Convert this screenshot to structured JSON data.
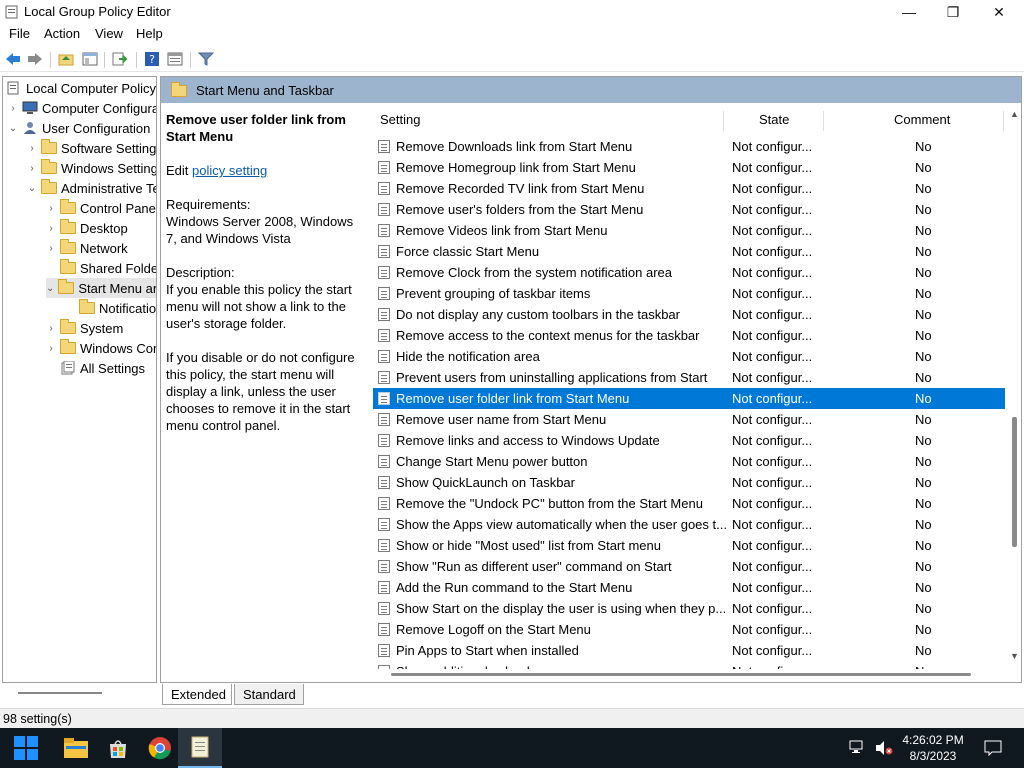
{
  "window": {
    "title": "Local Group Policy Editor",
    "controls": {
      "minimize": "—",
      "maximize": "❐",
      "close": "✕"
    }
  },
  "menu": [
    "File",
    "Action",
    "View",
    "Help"
  ],
  "toolbar_icons": [
    "back-icon",
    "forward-icon",
    "up-folder-icon",
    "show-hide-tree-icon",
    "export-list-icon",
    "help-icon",
    "properties-icon",
    "filter-icon"
  ],
  "tree": [
    {
      "label": "Local Computer Policy",
      "expander": "",
      "icon": "policy-icon"
    },
    {
      "label": "Computer Configuration",
      "expander": "›",
      "icon": "computer-icon"
    },
    {
      "label": "User Configuration",
      "expander": "⌄",
      "icon": "user-icon"
    },
    {
      "label": "Software Settings",
      "expander": "›",
      "icon": "folder-icon"
    },
    {
      "label": "Windows Settings",
      "expander": "›",
      "icon": "folder-icon"
    },
    {
      "label": "Administrative Templates",
      "expander": "⌄",
      "icon": "folder-icon"
    },
    {
      "label": "Control Panel",
      "expander": "›",
      "icon": "folder-icon"
    },
    {
      "label": "Desktop",
      "expander": "›",
      "icon": "folder-icon"
    },
    {
      "label": "Network",
      "expander": "›",
      "icon": "folder-icon"
    },
    {
      "label": "Shared Folders",
      "expander": "",
      "icon": "folder-icon"
    },
    {
      "label": "Start Menu and Taskbar",
      "expander": "⌄",
      "icon": "folder-icon"
    },
    {
      "label": "Notifications",
      "expander": "",
      "icon": "folder-icon"
    },
    {
      "label": "System",
      "expander": "›",
      "icon": "folder-icon"
    },
    {
      "label": "Windows Components",
      "expander": "›",
      "icon": "folder-icon"
    },
    {
      "label": "All Settings",
      "expander": "",
      "icon": "all-settings-icon"
    }
  ],
  "pane_header": "Start Menu and Taskbar",
  "description": {
    "title": "Remove user folder link from Start Menu",
    "edit_prefix": "Edit",
    "edit_link": "policy setting",
    "requirements_label": "Requirements:",
    "requirements": "Windows Server 2008, Windows 7, and Windows Vista",
    "description_label": "Description:",
    "para1": "If you enable this policy the start menu will not show a link to the user's storage folder.",
    "para2": "If you disable or do not configure this policy, the start menu will display a link, unless the user chooses to remove it in the start menu control panel."
  },
  "columns": {
    "setting": "Setting",
    "state": "State",
    "comment": "Comment"
  },
  "rows": [
    {
      "name": "Remove Downloads link from Start Menu",
      "state": "Not configur...",
      "comment": "No"
    },
    {
      "name": "Remove Homegroup link from Start Menu",
      "state": "Not configur...",
      "comment": "No"
    },
    {
      "name": "Remove Recorded TV link from Start Menu",
      "state": "Not configur...",
      "comment": "No"
    },
    {
      "name": "Remove user's folders from the Start Menu",
      "state": "Not configur...",
      "comment": "No"
    },
    {
      "name": "Remove Videos link from Start Menu",
      "state": "Not configur...",
      "comment": "No"
    },
    {
      "name": "Force classic Start Menu",
      "state": "Not configur...",
      "comment": "No"
    },
    {
      "name": "Remove Clock from the system notification area",
      "state": "Not configur...",
      "comment": "No"
    },
    {
      "name": "Prevent grouping of taskbar items",
      "state": "Not configur...",
      "comment": "No"
    },
    {
      "name": "Do not display any custom toolbars in the taskbar",
      "state": "Not configur...",
      "comment": "No"
    },
    {
      "name": "Remove access to the context menus for the taskbar",
      "state": "Not configur...",
      "comment": "No"
    },
    {
      "name": "Hide the notification area",
      "state": "Not configur...",
      "comment": "No"
    },
    {
      "name": "Prevent users from uninstalling applications from Start",
      "state": "Not configur...",
      "comment": "No"
    },
    {
      "name": "Remove user folder link from Start Menu",
      "state": "Not configur...",
      "comment": "No",
      "selected": true
    },
    {
      "name": "Remove user name from Start Menu",
      "state": "Not configur...",
      "comment": "No"
    },
    {
      "name": "Remove links and access to Windows Update",
      "state": "Not configur...",
      "comment": "No"
    },
    {
      "name": "Change Start Menu power button",
      "state": "Not configur...",
      "comment": "No"
    },
    {
      "name": "Show QuickLaunch on Taskbar",
      "state": "Not configur...",
      "comment": "No"
    },
    {
      "name": "Remove the \"Undock PC\" button from the Start Menu",
      "state": "Not configur...",
      "comment": "No"
    },
    {
      "name": "Show the Apps view automatically when the user goes t...",
      "state": "Not configur...",
      "comment": "No"
    },
    {
      "name": "Show or hide \"Most used\" list from Start menu",
      "state": "Not configur...",
      "comment": "No"
    },
    {
      "name": "Show \"Run as different user\" command on Start",
      "state": "Not configur...",
      "comment": "No"
    },
    {
      "name": "Add the Run command to the Start Menu",
      "state": "Not configur...",
      "comment": "No"
    },
    {
      "name": "Show Start on the display the user is using when they p...",
      "state": "Not configur...",
      "comment": "No"
    },
    {
      "name": "Remove Logoff on the Start Menu",
      "state": "Not configur...",
      "comment": "No"
    },
    {
      "name": "Pin Apps to Start when installed",
      "state": "Not configur...",
      "comment": "No"
    },
    {
      "name": "Show additional calendar",
      "state": "Not configur...",
      "comment": "No"
    }
  ],
  "tabs": [
    "Extended",
    "Standard"
  ],
  "status": "98 setting(s)",
  "taskbar": {
    "time": "4:26:02 PM",
    "date": "8/3/2023"
  },
  "colors": {
    "selection": "#0078d7",
    "pane_header": "#9db4cf",
    "taskbar": "#101820"
  }
}
